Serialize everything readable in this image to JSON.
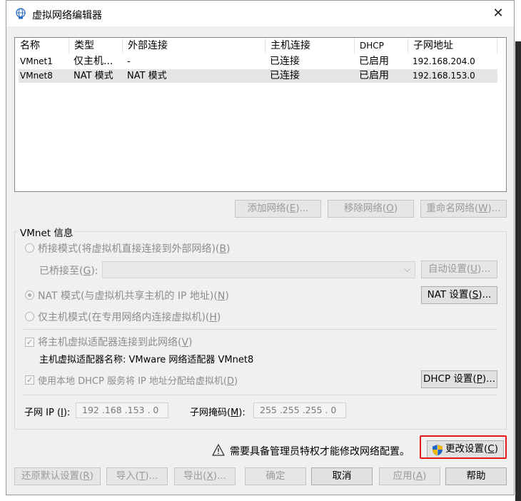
{
  "window": {
    "title": "虚拟网络编辑器",
    "close": "✕"
  },
  "table": {
    "columns": [
      "名称",
      "类型",
      "外部连接",
      "主机连接",
      "DHCP",
      "子网地址"
    ],
    "rows": [
      [
        "VMnet1",
        "仅主机...",
        "-",
        "已连接",
        "已启用",
        "192.168.204.0"
      ],
      [
        "VMnet8",
        "NAT 模式",
        "NAT 模式",
        "已连接",
        "已启用",
        "192.168.153.0"
      ]
    ]
  },
  "list_buttons": {
    "add": {
      "text": "添加网络(",
      "key": "E",
      "tail": ")..."
    },
    "remove": {
      "text": "移除网络(",
      "key": "O",
      "tail": ")"
    },
    "rename": {
      "text": "重命名网络(",
      "key": "W",
      "tail": ")..."
    }
  },
  "vmnet_info": {
    "group_label": "VMnet 信息",
    "bridged": {
      "text": "桥接模式(将虚拟机直接连接到外部网络)(",
      "key": "B",
      "tail": ")"
    },
    "bridged_to": {
      "text": "已桥接至(",
      "key": "G",
      "tail": "):"
    },
    "auto_settings": {
      "text": "自动设置(",
      "key": "U",
      "tail": ")..."
    },
    "nat": {
      "text": "NAT 模式(与虚拟机共享主机的 IP 地址)(",
      "key": "N",
      "tail": ")"
    },
    "nat_settings": {
      "text": "NAT 设置(",
      "key": "S",
      "tail": ")..."
    },
    "host_only": {
      "text": "仅主机模式(在专用网络内连接虚拟机)(",
      "key": "H",
      "tail": ")"
    },
    "connect_adapter": {
      "text": "将主机虚拟适配器连接到此网络(",
      "key": "V",
      "tail": ")",
      "checkmark": "✓"
    },
    "adapter_name": "主机虚拟适配器名称: VMware 网络适配器 VMnet8",
    "use_dhcp": {
      "text": "使用本地 DHCP 服务将 IP 地址分配给虚拟机(",
      "key": "D",
      "tail": ")",
      "checkmark": "✓"
    },
    "dhcp_settings": {
      "text": "DHCP 设置(",
      "key": "P",
      "tail": ")..."
    },
    "subnet_ip": {
      "text": "子网 IP (",
      "key": "I",
      "tail": "):",
      "value": "192 .168 .153 .  0"
    },
    "subnet_mask": {
      "text": "子网掩码(",
      "key": "M",
      "tail": "):",
      "value": "255 .255 .255 .  0"
    }
  },
  "admin": {
    "warning": "需要具备管理员特权才能修改网络配置。",
    "change_settings": {
      "text": "更改设置(",
      "key": "C",
      "tail": ")"
    }
  },
  "footer": {
    "restore": {
      "text": "还原默认设置(",
      "key": "R",
      "tail": ")"
    },
    "import": {
      "text": "导入(",
      "key": "T",
      "tail": ")..."
    },
    "export": {
      "text": "导出(",
      "key": "X",
      "tail": ")..."
    },
    "ok": "确定",
    "cancel": "取消",
    "apply": {
      "text": "应用(",
      "key": "A",
      "tail": ")"
    },
    "help": "帮助"
  }
}
